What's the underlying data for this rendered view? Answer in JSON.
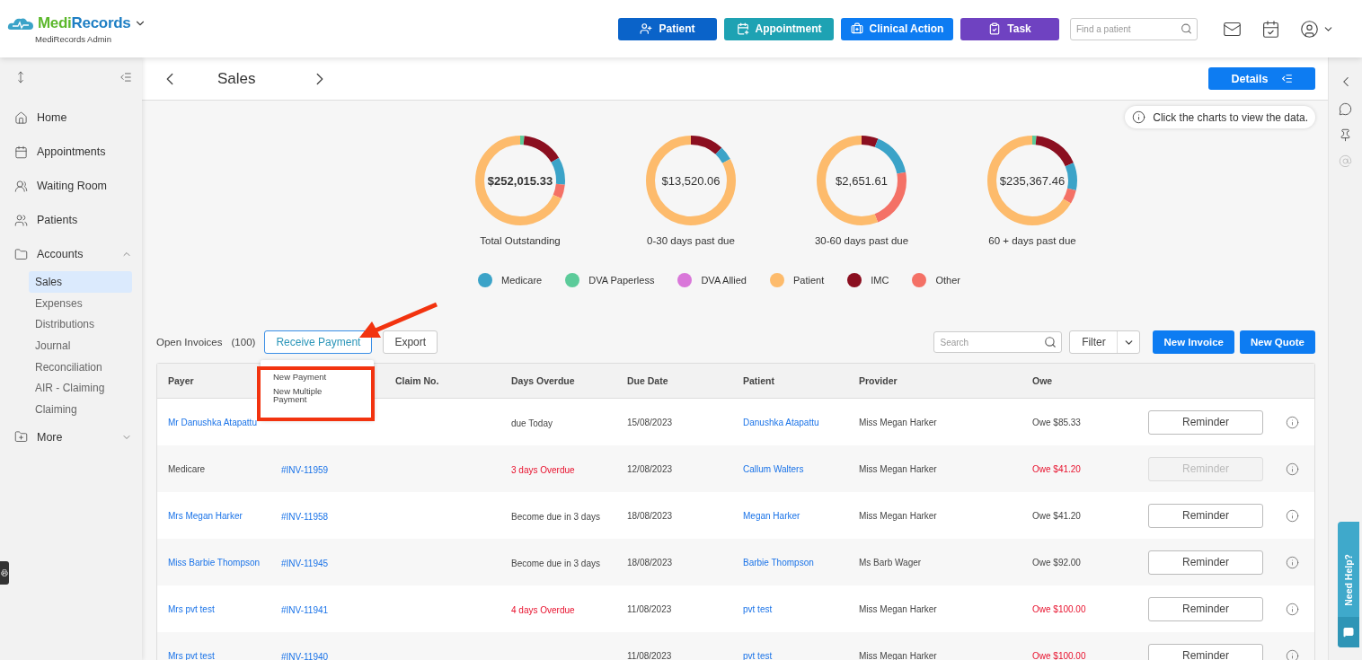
{
  "header": {
    "logo_parts": [
      "Medi",
      "Records"
    ],
    "practice": "MediRecords Admin",
    "actions": [
      {
        "label": "Patient",
        "kind": "patient"
      },
      {
        "label": "Appointment",
        "kind": "appointment"
      },
      {
        "label": "Clinical Action",
        "kind": "clinical"
      },
      {
        "label": "Task",
        "kind": "task"
      }
    ],
    "search": {
      "placeholder": "Find a patient"
    }
  },
  "sidebar": {
    "items": [
      {
        "label": "Home",
        "kind": "home",
        "selected": false
      },
      {
        "label": "Appointments",
        "kind": "calendar",
        "selected": false
      },
      {
        "label": "Waiting Room",
        "kind": "waiting",
        "selected": false
      },
      {
        "label": "Patients",
        "kind": "people",
        "selected": false
      },
      {
        "label": "Accounts",
        "kind": "folder",
        "selected": false,
        "expanded": true,
        "children": [
          {
            "label": "Sales",
            "selected": true
          },
          {
            "label": "Expenses",
            "selected": false
          },
          {
            "label": "Distributions",
            "selected": false
          },
          {
            "label": "Journal",
            "selected": false
          },
          {
            "label": "Reconciliation",
            "selected": false
          },
          {
            "label": "AIR - Claiming",
            "selected": false
          },
          {
            "label": "Claiming",
            "selected": false
          }
        ]
      },
      {
        "label": "More",
        "kind": "folder-plus",
        "selected": false,
        "expanded": false
      }
    ]
  },
  "page": {
    "title": "Sales",
    "details_button": "Details",
    "hint": "Click the charts to view the data."
  },
  "donuts": [
    {
      "amount": "$252,015.33",
      "label": "Total Outstanding",
      "bold": true
    },
    {
      "amount": "$13,520.06",
      "label": "0-30 days past due",
      "bold": false
    },
    {
      "amount": "$2,651.61",
      "label": "30-60 days past due",
      "bold": false
    },
    {
      "amount": "$235,367.46",
      "label": "60 + days past due",
      "bold": false
    }
  ],
  "legend": [
    {
      "label": "Medicare",
      "color": "#3ba3c8"
    },
    {
      "label": "DVA Paperless",
      "color": "#5ccb9a"
    },
    {
      "label": "DVA Allied",
      "color": "#d977d9"
    },
    {
      "label": "Patient",
      "color": "#fdbb6c"
    },
    {
      "label": "IMC",
      "color": "#8b0f20"
    },
    {
      "label": "Other",
      "color": "#f47166"
    }
  ],
  "toolbar": {
    "title": "Open Invoices",
    "count": "(100)",
    "receive_payment": "Receive Payment",
    "export": "Export",
    "search_placeholder": "Search",
    "filter": "Filter",
    "new_invoice": "New Invoice",
    "new_quote": "New Quote"
  },
  "payment_menu": [
    "New Payment",
    "New Multiple Payment"
  ],
  "table": {
    "columns": [
      "Payer",
      "",
      "Claim No.",
      "Days Overdue",
      "Due Date",
      "Patient",
      "Provider",
      "Owe"
    ],
    "rows": [
      {
        "payer": "Mr Danushka Atapattu",
        "payer_link": true,
        "invoice": "",
        "claim": "",
        "days": "due Today",
        "due": "15/08/2023",
        "patient": "Danushka Atapattu",
        "provider": "Miss Megan Harker",
        "owe": "Owe $85.33",
        "overdue": false,
        "reminder": "Reminder",
        "reminder_disabled": false
      },
      {
        "payer": "Medicare",
        "payer_link": false,
        "invoice": "#INV-11959",
        "claim": "",
        "days": "3 days Overdue",
        "due": "12/08/2023",
        "patient": "Callum Walters",
        "provider": "Miss Megan Harker",
        "owe": "Owe $41.20",
        "overdue": true,
        "reminder": "Reminder",
        "reminder_disabled": true
      },
      {
        "payer": "Mrs Megan Harker",
        "payer_link": true,
        "invoice": "#INV-11958",
        "claim": "",
        "days": "Become due in 3 days",
        "due": "18/08/2023",
        "patient": "Megan Harker",
        "provider": "Miss Megan Harker",
        "owe": "Owe $41.20",
        "overdue": false,
        "reminder": "Reminder",
        "reminder_disabled": false
      },
      {
        "payer": "Miss Barbie Thompson",
        "payer_link": true,
        "invoice": "#INV-11945",
        "claim": "",
        "days": "Become due in 3 days",
        "due": "18/08/2023",
        "patient": "Barbie Thompson",
        "provider": "Ms Barb Wager",
        "owe": "Owe $92.00",
        "overdue": false,
        "reminder": "Reminder",
        "reminder_disabled": false
      },
      {
        "payer": "Mrs pvt test",
        "payer_link": true,
        "invoice": "#INV-11941",
        "claim": "",
        "days": "4 days Overdue",
        "due": "11/08/2023",
        "patient": "pvt test",
        "provider": "Miss Megan Harker",
        "owe": "Owe $100.00",
        "overdue": true,
        "reminder": "Reminder",
        "reminder_disabled": false
      },
      {
        "payer": "Mrs pvt test",
        "payer_link": true,
        "invoice": "#INV-11940",
        "claim": "",
        "days": "",
        "due": "11/08/2023",
        "patient": "pvt test",
        "provider": "Miss Megan Harker",
        "owe": "Owe $100.00",
        "overdue": true,
        "reminder": "Reminder",
        "reminder_disabled": false
      }
    ]
  },
  "help_tab": "Need Help?"
}
